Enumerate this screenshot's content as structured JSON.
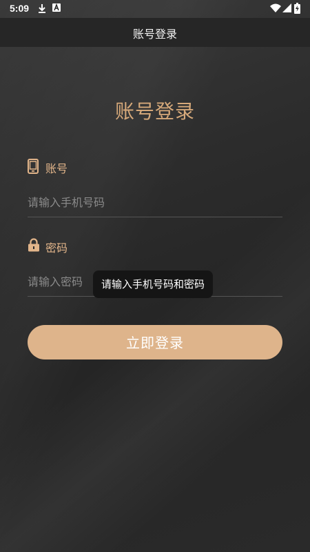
{
  "status_bar": {
    "time": "5:09",
    "icons": [
      "download-icon",
      "a-icon",
      "wifi-icon",
      "signal-icon",
      "battery-icon"
    ]
  },
  "title_bar": {
    "title": "账号登录"
  },
  "form": {
    "heading": "账号登录",
    "account": {
      "label": "账号",
      "icon": "phone-icon",
      "placeholder": "请输入手机号码",
      "value": ""
    },
    "password": {
      "label": "密码",
      "icon": "lock-icon",
      "placeholder": "请输入密码",
      "value": ""
    },
    "submit_label": "立即登录"
  },
  "toast": {
    "message": "请输入手机号码和密码"
  },
  "colors": {
    "accent": "#deb48b",
    "heading": "#d6a97a",
    "background": "#2a2a2a"
  }
}
